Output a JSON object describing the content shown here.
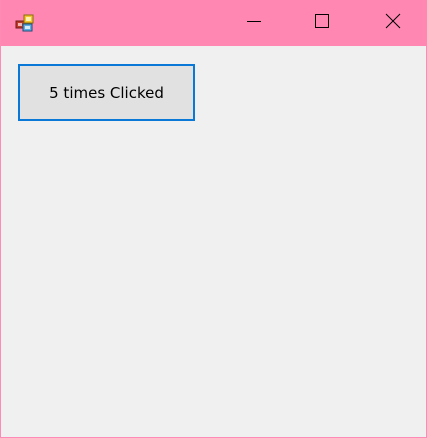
{
  "window": {
    "icon": "app-icon",
    "controls": {
      "minimize_icon": "minimize-icon",
      "maximize_icon": "maximize-icon",
      "close_icon": "close-icon"
    },
    "titlebar_color": "#ff87b2"
  },
  "main": {
    "button_label": "5 times Clicked",
    "button_border_color": "#0a78d7",
    "button_background": "#e1e1e1"
  }
}
